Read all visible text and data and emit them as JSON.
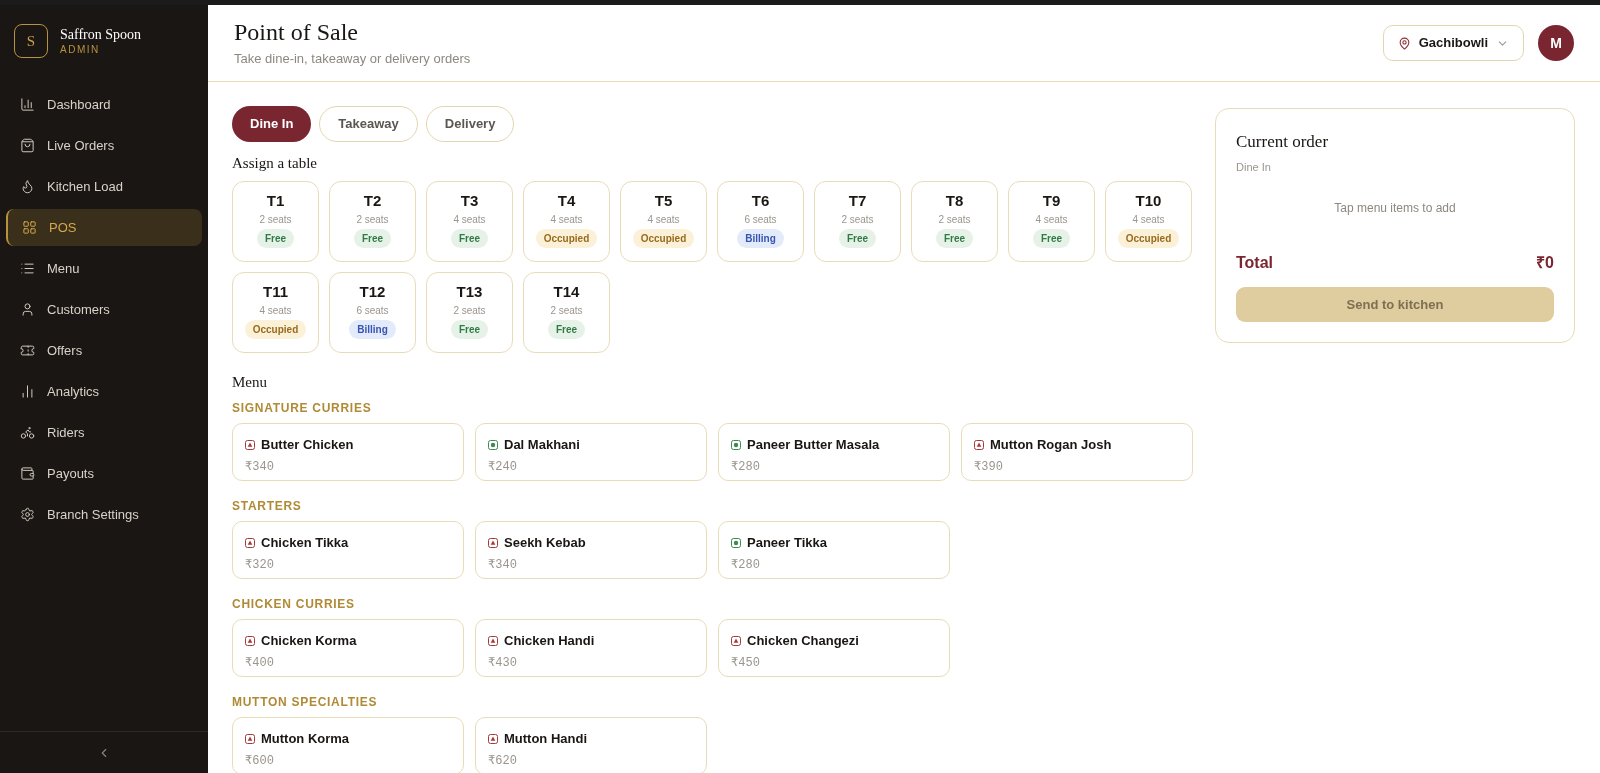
{
  "brand": {
    "logo_letter": "S",
    "name": "Saffron Spoon",
    "role": "ADMIN"
  },
  "sidebar": {
    "items": [
      {
        "label": "Dashboard",
        "selected": false
      },
      {
        "label": "Live Orders",
        "selected": false
      },
      {
        "label": "Kitchen Load",
        "selected": false
      },
      {
        "label": "POS",
        "selected": true
      },
      {
        "label": "Menu",
        "selected": false
      },
      {
        "label": "Customers",
        "selected": false
      },
      {
        "label": "Offers",
        "selected": false
      },
      {
        "label": "Analytics",
        "selected": false
      },
      {
        "label": "Riders",
        "selected": false
      },
      {
        "label": "Payouts",
        "selected": false
      },
      {
        "label": "Branch Settings",
        "selected": false
      }
    ]
  },
  "header": {
    "title": "Point of Sale",
    "subtitle": "Take dine-in, takeaway or delivery orders",
    "branch": "Gachibowli",
    "avatar": "M"
  },
  "order_types": [
    {
      "label": "Dine In",
      "selected": true
    },
    {
      "label": "Takeaway",
      "selected": false
    },
    {
      "label": "Delivery",
      "selected": false
    }
  ],
  "tables_heading": "Assign a table",
  "tables": [
    {
      "name": "T1",
      "seats": "2 seats",
      "status": "Free",
      "kind": "free"
    },
    {
      "name": "T2",
      "seats": "2 seats",
      "status": "Free",
      "kind": "free"
    },
    {
      "name": "T3",
      "seats": "4 seats",
      "status": "Free",
      "kind": "free"
    },
    {
      "name": "T4",
      "seats": "4 seats",
      "status": "Occupied",
      "kind": "occupied"
    },
    {
      "name": "T5",
      "seats": "4 seats",
      "status": "Occupied",
      "kind": "occupied"
    },
    {
      "name": "T6",
      "seats": "6 seats",
      "status": "Billing",
      "kind": "billing"
    },
    {
      "name": "T7",
      "seats": "2 seats",
      "status": "Free",
      "kind": "free"
    },
    {
      "name": "T8",
      "seats": "2 seats",
      "status": "Free",
      "kind": "free"
    },
    {
      "name": "T9",
      "seats": "4 seats",
      "status": "Free",
      "kind": "free"
    },
    {
      "name": "T10",
      "seats": "4 seats",
      "status": "Occupied",
      "kind": "occupied"
    },
    {
      "name": "T11",
      "seats": "4 seats",
      "status": "Occupied",
      "kind": "occupied"
    },
    {
      "name": "T12",
      "seats": "6 seats",
      "status": "Billing",
      "kind": "billing"
    },
    {
      "name": "T13",
      "seats": "2 seats",
      "status": "Free",
      "kind": "free"
    },
    {
      "name": "T14",
      "seats": "2 seats",
      "status": "Free",
      "kind": "free"
    }
  ],
  "menu_heading": "Menu",
  "menu": [
    {
      "category": "SIGNATURE CURRIES",
      "items": [
        {
          "name": "Butter Chicken",
          "price": "₹340",
          "kind": "non_veg"
        },
        {
          "name": "Dal Makhani",
          "price": "₹240",
          "kind": "veg"
        },
        {
          "name": "Paneer Butter Masala",
          "price": "₹280",
          "kind": "veg"
        },
        {
          "name": "Mutton Rogan Josh",
          "price": "₹390",
          "kind": "non_veg"
        }
      ]
    },
    {
      "category": "STARTERS",
      "items": [
        {
          "name": "Chicken Tikka",
          "price": "₹320",
          "kind": "non_veg"
        },
        {
          "name": "Seekh Kebab",
          "price": "₹340",
          "kind": "non_veg"
        },
        {
          "name": "Paneer Tikka",
          "price": "₹280",
          "kind": "veg"
        }
      ]
    },
    {
      "category": "CHICKEN CURRIES",
      "items": [
        {
          "name": "Chicken Korma",
          "price": "₹400",
          "kind": "non_veg"
        },
        {
          "name": "Chicken Handi",
          "price": "₹430",
          "kind": "non_veg"
        },
        {
          "name": "Chicken Changezi",
          "price": "₹450",
          "kind": "non_veg"
        }
      ]
    },
    {
      "category": "MUTTON SPECIALTIES",
      "items": [
        {
          "name": "Mutton Korma",
          "price": "₹600",
          "kind": "non_veg"
        },
        {
          "name": "Mutton Handi",
          "price": "₹620",
          "kind": "non_veg"
        }
      ]
    }
  ],
  "order": {
    "title": "Current order",
    "type": "Dine In",
    "empty_hint": "Tap menu items to add",
    "total_label": "Total",
    "total": "₹0",
    "submit": "Send to kitchen",
    "submit_disabled": true
  }
}
